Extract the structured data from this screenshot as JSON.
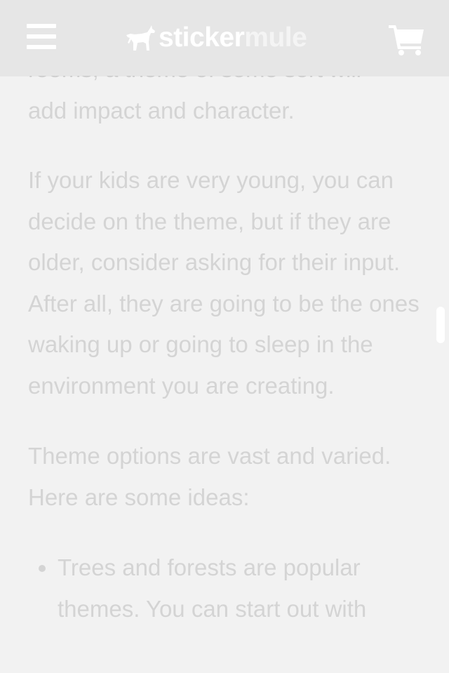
{
  "header": {
    "brand_sticker": "sticker",
    "brand_mule": "mule",
    "icons": {
      "menu": "hamburger-menu-icon",
      "logo": "mule-logo-icon",
      "cart": "shopping-cart-icon"
    }
  },
  "article": {
    "partial_line": "rooms, a theme of some sort will",
    "paragraphs": [
      "add impact and character.",
      "If your kids are very young, you can decide on the theme, but if they are older, consider asking for their input. After all, they are going to be the ones waking up or going to sleep in the environment you are creating.",
      "Theme options are vast and varied. Here are some ideas:"
    ],
    "list_items": [
      "Trees and forests are popular themes. You can start out with"
    ]
  },
  "colors": {
    "header_bg": "#e6e6e6",
    "page_bg": "#f2f2f2",
    "text": "#d4d4d4",
    "header_icons": "#ffffff"
  }
}
